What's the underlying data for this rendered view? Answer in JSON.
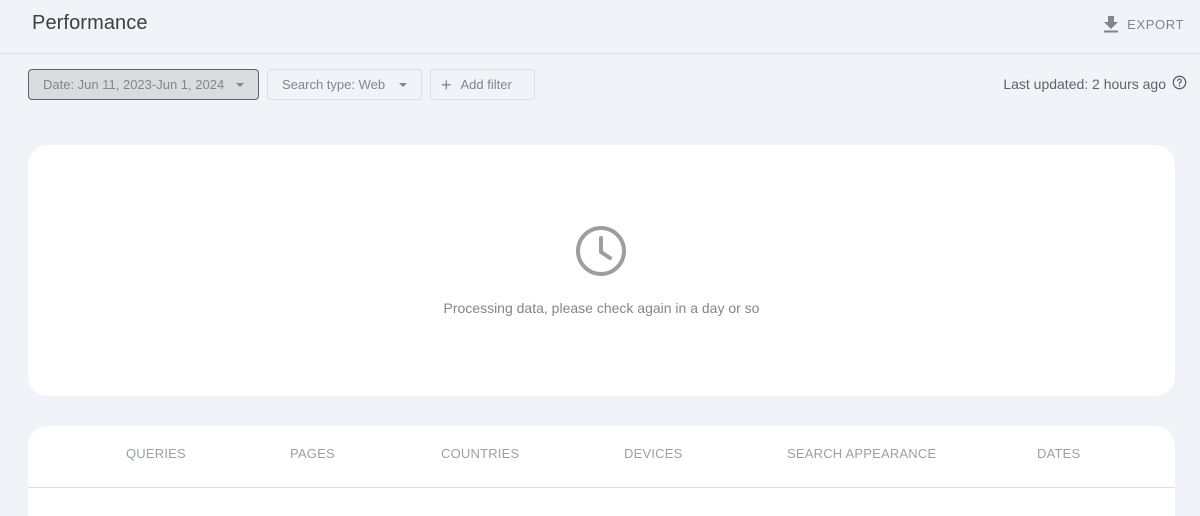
{
  "header": {
    "title": "Performance",
    "export_label": "EXPORT"
  },
  "filters": {
    "date_label": "Date: Jun 11, 2023-Jun 1, 2024",
    "search_type_label": "Search type: Web",
    "add_filter_label": "Add filter"
  },
  "status": {
    "last_updated": "Last updated: 2 hours ago"
  },
  "empty_state": {
    "icon": "clock-icon",
    "message": "Processing data, please check again in a day or so"
  },
  "tabs": [
    {
      "label": "QUERIES"
    },
    {
      "label": "PAGES"
    },
    {
      "label": "COUNTRIES"
    },
    {
      "label": "DEVICES"
    },
    {
      "label": "SEARCH APPEARANCE"
    },
    {
      "label": "DATES"
    }
  ]
}
